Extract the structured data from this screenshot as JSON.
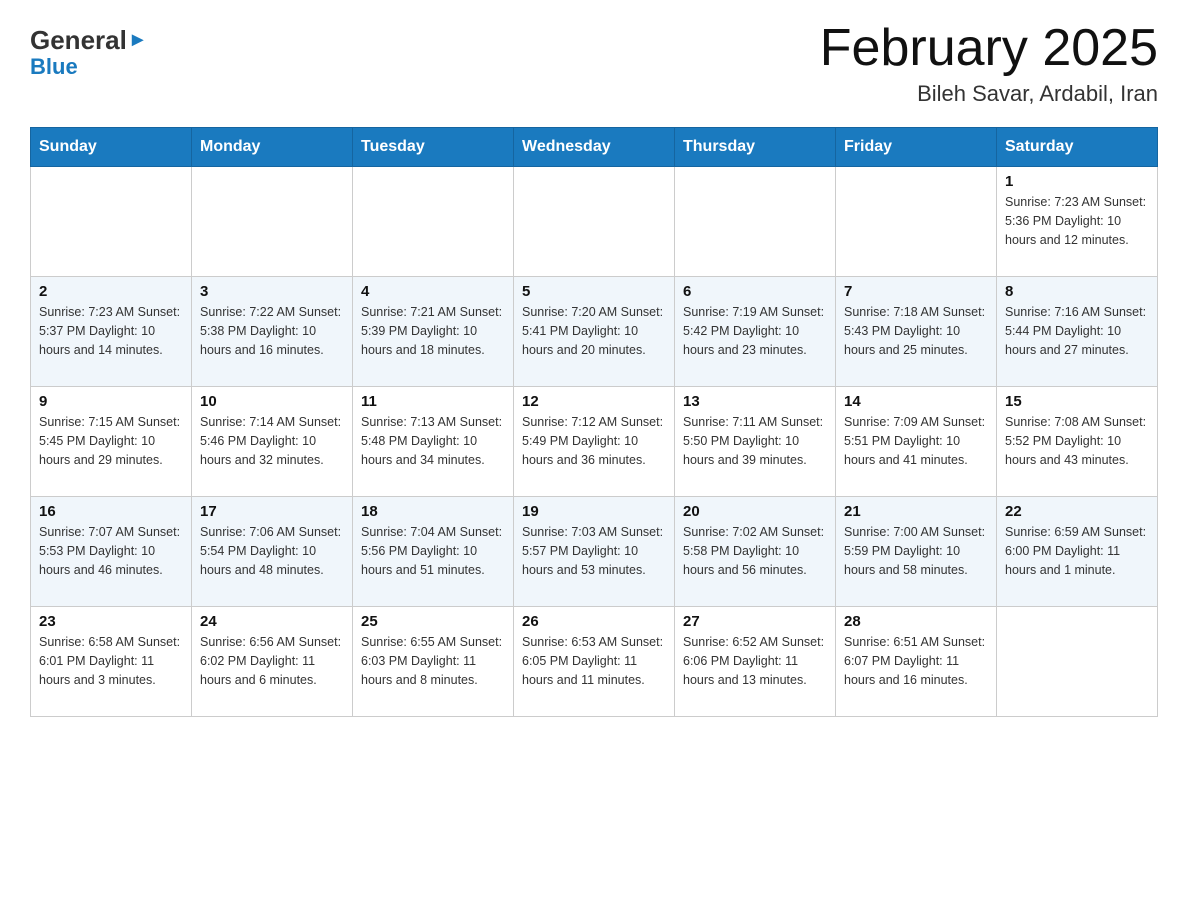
{
  "header": {
    "logo_general": "General",
    "logo_blue": "Blue",
    "month_year": "February 2025",
    "location": "Bileh Savar, Ardabil, Iran"
  },
  "days_of_week": [
    "Sunday",
    "Monday",
    "Tuesday",
    "Wednesday",
    "Thursday",
    "Friday",
    "Saturday"
  ],
  "weeks": [
    [
      {
        "day": "",
        "info": ""
      },
      {
        "day": "",
        "info": ""
      },
      {
        "day": "",
        "info": ""
      },
      {
        "day": "",
        "info": ""
      },
      {
        "day": "",
        "info": ""
      },
      {
        "day": "",
        "info": ""
      },
      {
        "day": "1",
        "info": "Sunrise: 7:23 AM\nSunset: 5:36 PM\nDaylight: 10 hours and 12 minutes."
      }
    ],
    [
      {
        "day": "2",
        "info": "Sunrise: 7:23 AM\nSunset: 5:37 PM\nDaylight: 10 hours and 14 minutes."
      },
      {
        "day": "3",
        "info": "Sunrise: 7:22 AM\nSunset: 5:38 PM\nDaylight: 10 hours and 16 minutes."
      },
      {
        "day": "4",
        "info": "Sunrise: 7:21 AM\nSunset: 5:39 PM\nDaylight: 10 hours and 18 minutes."
      },
      {
        "day": "5",
        "info": "Sunrise: 7:20 AM\nSunset: 5:41 PM\nDaylight: 10 hours and 20 minutes."
      },
      {
        "day": "6",
        "info": "Sunrise: 7:19 AM\nSunset: 5:42 PM\nDaylight: 10 hours and 23 minutes."
      },
      {
        "day": "7",
        "info": "Sunrise: 7:18 AM\nSunset: 5:43 PM\nDaylight: 10 hours and 25 minutes."
      },
      {
        "day": "8",
        "info": "Sunrise: 7:16 AM\nSunset: 5:44 PM\nDaylight: 10 hours and 27 minutes."
      }
    ],
    [
      {
        "day": "9",
        "info": "Sunrise: 7:15 AM\nSunset: 5:45 PM\nDaylight: 10 hours and 29 minutes."
      },
      {
        "day": "10",
        "info": "Sunrise: 7:14 AM\nSunset: 5:46 PM\nDaylight: 10 hours and 32 minutes."
      },
      {
        "day": "11",
        "info": "Sunrise: 7:13 AM\nSunset: 5:48 PM\nDaylight: 10 hours and 34 minutes."
      },
      {
        "day": "12",
        "info": "Sunrise: 7:12 AM\nSunset: 5:49 PM\nDaylight: 10 hours and 36 minutes."
      },
      {
        "day": "13",
        "info": "Sunrise: 7:11 AM\nSunset: 5:50 PM\nDaylight: 10 hours and 39 minutes."
      },
      {
        "day": "14",
        "info": "Sunrise: 7:09 AM\nSunset: 5:51 PM\nDaylight: 10 hours and 41 minutes."
      },
      {
        "day": "15",
        "info": "Sunrise: 7:08 AM\nSunset: 5:52 PM\nDaylight: 10 hours and 43 minutes."
      }
    ],
    [
      {
        "day": "16",
        "info": "Sunrise: 7:07 AM\nSunset: 5:53 PM\nDaylight: 10 hours and 46 minutes."
      },
      {
        "day": "17",
        "info": "Sunrise: 7:06 AM\nSunset: 5:54 PM\nDaylight: 10 hours and 48 minutes."
      },
      {
        "day": "18",
        "info": "Sunrise: 7:04 AM\nSunset: 5:56 PM\nDaylight: 10 hours and 51 minutes."
      },
      {
        "day": "19",
        "info": "Sunrise: 7:03 AM\nSunset: 5:57 PM\nDaylight: 10 hours and 53 minutes."
      },
      {
        "day": "20",
        "info": "Sunrise: 7:02 AM\nSunset: 5:58 PM\nDaylight: 10 hours and 56 minutes."
      },
      {
        "day": "21",
        "info": "Sunrise: 7:00 AM\nSunset: 5:59 PM\nDaylight: 10 hours and 58 minutes."
      },
      {
        "day": "22",
        "info": "Sunrise: 6:59 AM\nSunset: 6:00 PM\nDaylight: 11 hours and 1 minute."
      }
    ],
    [
      {
        "day": "23",
        "info": "Sunrise: 6:58 AM\nSunset: 6:01 PM\nDaylight: 11 hours and 3 minutes."
      },
      {
        "day": "24",
        "info": "Sunrise: 6:56 AM\nSunset: 6:02 PM\nDaylight: 11 hours and 6 minutes."
      },
      {
        "day": "25",
        "info": "Sunrise: 6:55 AM\nSunset: 6:03 PM\nDaylight: 11 hours and 8 minutes."
      },
      {
        "day": "26",
        "info": "Sunrise: 6:53 AM\nSunset: 6:05 PM\nDaylight: 11 hours and 11 minutes."
      },
      {
        "day": "27",
        "info": "Sunrise: 6:52 AM\nSunset: 6:06 PM\nDaylight: 11 hours and 13 minutes."
      },
      {
        "day": "28",
        "info": "Sunrise: 6:51 AM\nSunset: 6:07 PM\nDaylight: 11 hours and 16 minutes."
      },
      {
        "day": "",
        "info": ""
      }
    ]
  ]
}
